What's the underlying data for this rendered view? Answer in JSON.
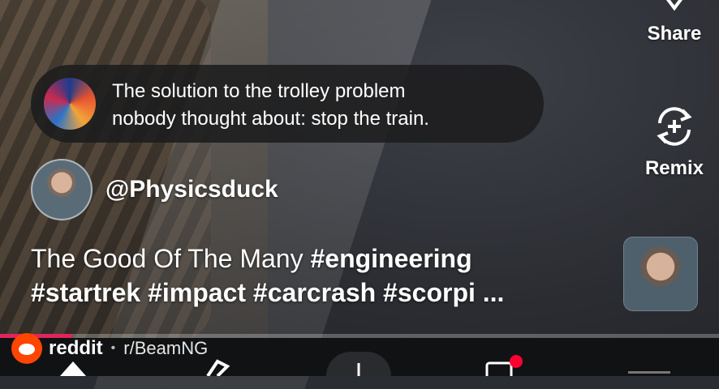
{
  "actions": {
    "share_label": "Share",
    "remix_label": "Remix"
  },
  "caption": {
    "line1": "The solution to the trolley problem",
    "line2": "nobody thought about: stop the train."
  },
  "author": {
    "handle": "@Physicsduck"
  },
  "description": {
    "title": "The Good Of The Many",
    "tags_line1": "#engineering",
    "tags_line2": "#startrek #impact #carcrash #scorpi ..."
  },
  "progress": {
    "fraction": 0.1
  },
  "footer": {
    "brand": "reddit",
    "separator": "•",
    "subreddit": "r/BeamNG"
  },
  "colors": {
    "accent": "#e0245e",
    "reddit": "#ff4500",
    "badge": "#ff0033"
  }
}
